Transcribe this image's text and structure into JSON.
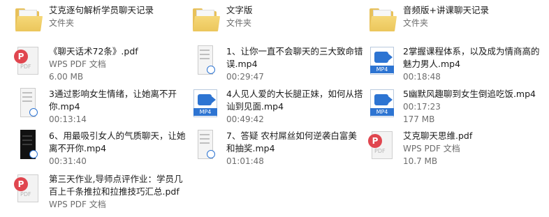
{
  "items": [
    {
      "name": "艾克逐句解析学员聊天记录",
      "sub1": "文件夹",
      "sub2": "",
      "icon": "folder-icon"
    },
    {
      "name": "文字版",
      "sub1": "文件夹",
      "sub2": "",
      "icon": "folder-icon"
    },
    {
      "name": "音频版+讲课聊天记录",
      "sub1": "文件夹",
      "sub2": "",
      "icon": "folder-icon"
    },
    {
      "name": "《聊天话术72条》.pdf",
      "sub1": "WPS PDF 文档",
      "sub2": "6.00 MB",
      "icon": "pdf-icon"
    },
    {
      "name": "1、让你一直不会聊天的三大致命错",
      "name2": "误.mp4",
      "sub1": "00:29:47",
      "sub2": "",
      "icon": "video-thumbnail-icon"
    },
    {
      "name": "2掌握课程体系，以及成为情商高的",
      "name2": "魅力男人.mp4",
      "sub1": "00:18:48",
      "sub2": "",
      "icon": "mp4-icon"
    },
    {
      "name": "3通过影响女生情绪，让她离不开",
      "name2": "你.mp4",
      "sub1": "00:13:14",
      "sub2": "",
      "icon": "video-thumbnail-icon"
    },
    {
      "name": "4人见人爱的大长腿正妹，如何从搭",
      "name2": "讪到见面.mp4",
      "sub1": "00:49:42",
      "sub2": "",
      "icon": "mp4-icon"
    },
    {
      "name": "5幽默风趣聊到女生倒追吃饭.mp4",
      "sub1": "00:17:23",
      "sub2": "177 MB",
      "icon": "mp4-icon"
    },
    {
      "name": "6、用最吸引女人的气质聊天，让她",
      "name2": "离不开你.mp4",
      "sub1": "00:31:40",
      "sub2": "",
      "icon": "video-thumbnail-dark-icon"
    },
    {
      "name": "7、答疑  农村屌丝如何逆袭白富美",
      "name2": "和抽奖.mp4",
      "sub1": "01:01:48",
      "sub2": "",
      "icon": "video-thumbnail-icon"
    },
    {
      "name": "艾克聊天思维.pdf",
      "sub1": "WPS PDF 文档",
      "sub2": "10.7 MB",
      "icon": "pdf-icon"
    },
    {
      "name": "第三天作业,导师点评作业：学员几",
      "name2": "百上千条推拉和拉推技巧汇总.pdf",
      "sub1": "WPS PDF 文档",
      "sub2": "",
      "icon": "pdf-icon"
    }
  ],
  "labels": {
    "pdf": "PDF",
    "mp4": "MP4",
    "pdf_badge": "P"
  }
}
